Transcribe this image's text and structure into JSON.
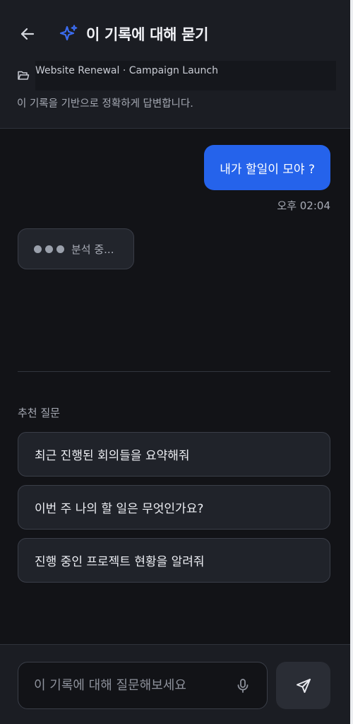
{
  "header": {
    "title": "이 기록에 대해 묻기",
    "back_icon": "arrow-left-icon",
    "title_icon": "sparkle-icon",
    "accent_color": "#2563eb"
  },
  "context": {
    "folder_icon": "folder-icon",
    "label": "Website Renewal · Campaign Launch",
    "subtitle": "이 기록을 기반으로 정확하게 답변합니다."
  },
  "chat": {
    "user_message": "내가 할일이 모야 ?",
    "user_message_time": "오후 02:04",
    "assistant_status": "분석 중..."
  },
  "suggestions": {
    "heading": "추천 질문",
    "items": [
      "최근 진행된 회의들을 요약해줘",
      "이번 주 나의 할 일은 무엇인가요?",
      "진행 중인 프로젝트 현황을 알려줘"
    ]
  },
  "composer": {
    "placeholder": "이 기록에 대해 질문해보세요",
    "value": "",
    "mic_icon": "microphone-icon",
    "send_icon": "send-icon"
  }
}
